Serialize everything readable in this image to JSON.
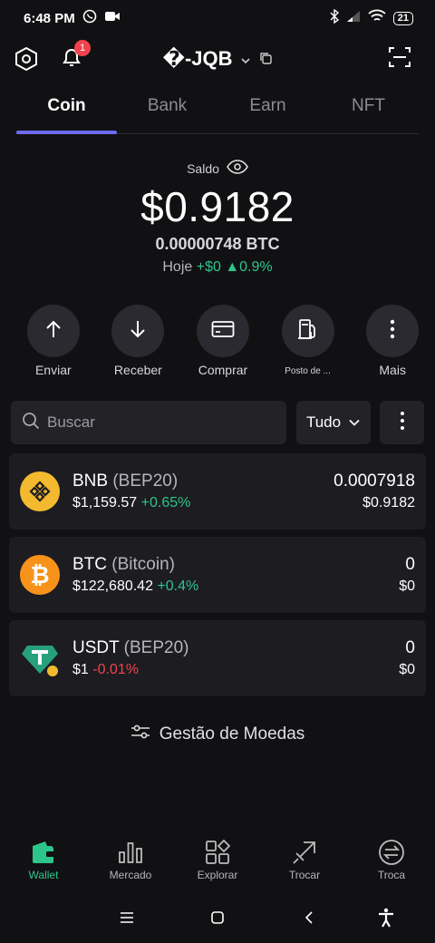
{
  "status_bar": {
    "time": "6:48 PM",
    "battery": "21"
  },
  "header": {
    "wallet_name": "�-JQB",
    "notification_count": "1"
  },
  "tabs": [
    "Coin",
    "Bank",
    "Earn",
    "NFT"
  ],
  "balance": {
    "label": "Saldo",
    "usd": "$0.9182",
    "btc": "0.00000748 BTC",
    "today_label": "Hoje",
    "today_change": "+$0",
    "today_pct": "0.9%"
  },
  "actions": [
    {
      "label": "Enviar",
      "icon": "arrow-up-icon"
    },
    {
      "label": "Receber",
      "icon": "arrow-down-icon"
    },
    {
      "label": "Comprar",
      "icon": "card-icon"
    },
    {
      "label": "Posto de ...",
      "icon": "gas-station-icon"
    },
    {
      "label": "Mais",
      "icon": "more-vertical-icon"
    }
  ],
  "search": {
    "placeholder": "Buscar",
    "filter": "Tudo"
  },
  "coins": [
    {
      "symbol": "BNB",
      "network": "(BEP20)",
      "price": "$1,159.57",
      "change": "+0.65%",
      "amount": "0.0007918",
      "value": "$0.9182"
    },
    {
      "symbol": "BTC",
      "network": "(Bitcoin)",
      "price": "$122,680.42",
      "change": "+0.4%",
      "amount": "0",
      "value": "$0"
    },
    {
      "symbol": "USDT",
      "network": "(BEP20)",
      "price": "$1",
      "change": "-0.01%",
      "amount": "0",
      "value": "$0"
    }
  ],
  "manage_label": "Gestão de Moedas",
  "bottom_nav": [
    {
      "label": "Wallet"
    },
    {
      "label": "Mercado"
    },
    {
      "label": "Explorar"
    },
    {
      "label": "Trocar"
    },
    {
      "label": "Troca"
    }
  ],
  "colors": {
    "accent": "#6e6af2",
    "positive": "#2ec58a",
    "negative": "#f2434b",
    "background": "#111114",
    "card": "#1c1c21"
  }
}
